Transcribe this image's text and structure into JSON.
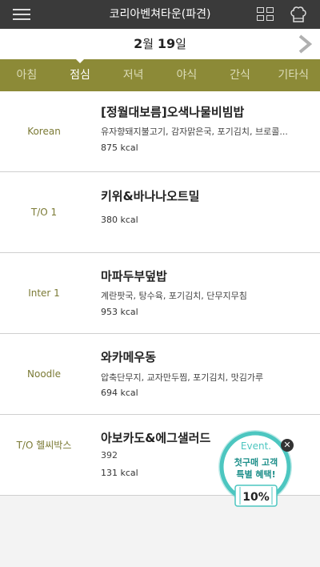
{
  "header": {
    "title": "코리아벤쳐타운(파견)",
    "menu_icon": "hamburger-icon",
    "grid_icon": "grid-icon",
    "chef_icon": "chef-hat-icon"
  },
  "date": {
    "month": "2",
    "month_unit": "월",
    "day": "19",
    "day_unit": "일",
    "next_icon": "chevron-right-icon"
  },
  "tabs": [
    {
      "label": "아침",
      "active": false
    },
    {
      "label": "점심",
      "active": true
    },
    {
      "label": "저녁",
      "active": false
    },
    {
      "label": "야식",
      "active": false
    },
    {
      "label": "간식",
      "active": false
    },
    {
      "label": "기타식",
      "active": false
    }
  ],
  "meals": [
    {
      "corner": "Korean",
      "name": "[정월대보름]오색나물비빔밥",
      "sides": "유자향돼지불고기, 감자맑은국, 포기김치, 브로콜...",
      "kcal": "875 kcal"
    },
    {
      "corner": "T/O 1",
      "name": "키위&바나나오트밀",
      "sides": "",
      "kcal": "380 kcal"
    },
    {
      "corner": "Inter 1",
      "name": "마파두부덮밥",
      "sides": "계란팟국, 탕수육, 포기김치, 단무지무침",
      "kcal": "953 kcal"
    },
    {
      "corner": "Noodle",
      "name": "와카메우동",
      "sides": "압축단무지, 교자만두찜, 포기김치, 맛김가루",
      "kcal": "694 kcal"
    },
    {
      "corner": "T/O 헬씨박스",
      "name": "아보카도&에그샐러드",
      "sides": "392",
      "kcal": "131 kcal"
    }
  ],
  "event_banner": {
    "label": "Event.",
    "line1": "첫구매 고객",
    "line2": "특별 혜택!",
    "discount": "10%",
    "close_icon": "close-icon",
    "colors": {
      "ring": "#4cc6c0",
      "bg": "#ffffff",
      "text": "#1e8f8a"
    }
  },
  "colors": {
    "topbar": "#3a3a3a",
    "tabbar": "#8c8a37",
    "corner_text": "#7b7a35"
  }
}
